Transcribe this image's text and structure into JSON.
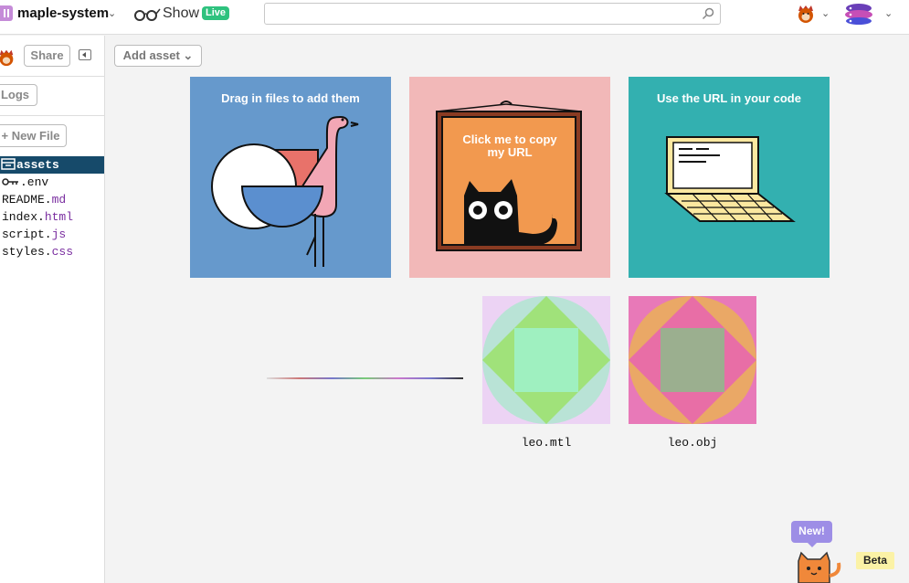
{
  "topbar": {
    "project_name": "maple-system",
    "show_label": "Show",
    "live_badge": "Live",
    "search_value": ""
  },
  "sidebar": {
    "share_label": "Share",
    "logs_label": "Logs",
    "new_file_label": "+ New File",
    "files": [
      {
        "name": "assets",
        "ext": ""
      },
      {
        "name": ".env",
        "ext": ""
      },
      {
        "name": "README.",
        "ext": "md"
      },
      {
        "name": "index.",
        "ext": "html"
      },
      {
        "name": "script.",
        "ext": "js"
      },
      {
        "name": "styles.",
        "ext": "css"
      }
    ]
  },
  "main": {
    "add_asset_label": "Add asset",
    "cards": [
      {
        "title": "Drag in files to add them",
        "color": "#6699cc"
      },
      {
        "title": "Click me to copy my URL",
        "color": "#f2b8b8"
      },
      {
        "title": "Use the URL in your code",
        "color": "#33b0b0"
      }
    ],
    "assets": [
      {
        "name": "leo.mtl"
      },
      {
        "name": "leo.obj"
      }
    ]
  },
  "footer": {
    "new_label": "New!",
    "beta_label": "Beta"
  },
  "icons": [
    "project-icon",
    "glasses-icon",
    "search-icon",
    "chevron-down-icon",
    "user-avatar",
    "team-avatar",
    "collapse-icon",
    "folder-icon",
    "key-icon",
    "cat-mascot"
  ]
}
